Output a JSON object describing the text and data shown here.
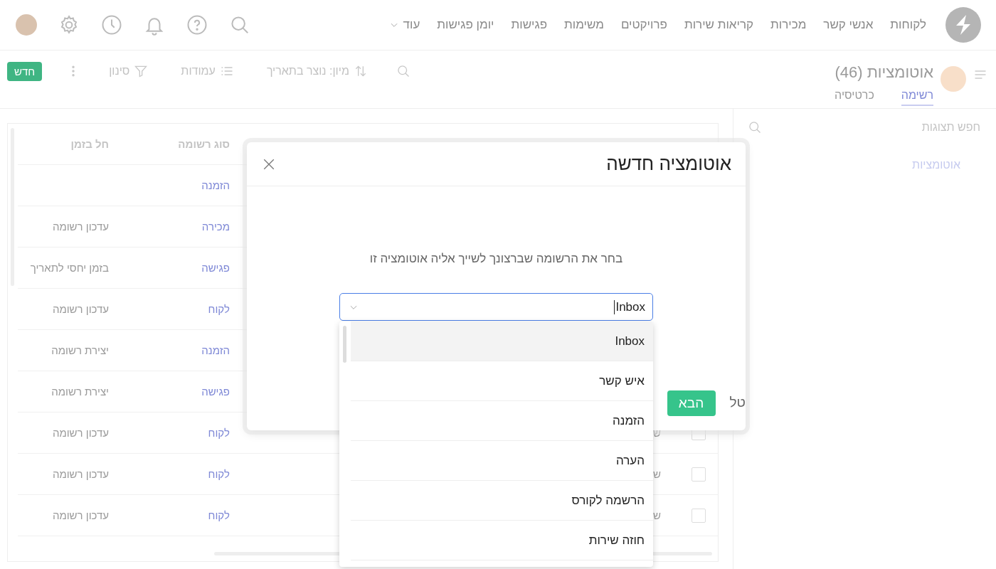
{
  "top_nav": {
    "items": [
      {
        "label": "לקוחות"
      },
      {
        "label": "אנשי קשר"
      },
      {
        "label": "מכירות"
      },
      {
        "label": "קריאות שירות"
      },
      {
        "label": "פרויקטים"
      },
      {
        "label": "משימות"
      },
      {
        "label": "פגישות"
      },
      {
        "label": "יומן פגישות"
      }
    ],
    "more": "עוד"
  },
  "page_header": {
    "title": "אוטומציות (46)",
    "tabs": [
      {
        "label": "רשימה",
        "selected": true
      },
      {
        "label": "כרטיסיה",
        "selected": false
      }
    ],
    "toolbar": {
      "sort": "מיון: נוצר בתאריך",
      "columns": "עמודות",
      "filter": "סינון",
      "new": "חדש"
    }
  },
  "sidebar": {
    "search": {
      "placeholder": "חפש תצוגות"
    },
    "items": [
      {
        "label": "אוטומציות",
        "selected": true
      }
    ]
  },
  "table": {
    "columns": [
      "סוג רשומה",
      "חל בזמן"
    ],
    "rows": [
      {
        "record_type": "הזמנה"
      },
      {
        "record_type": "מכירה",
        "applies_when": "עדכון רשומה"
      },
      {
        "record_type": "פגישה",
        "applies_when": "בזמן יחסי לתאריך"
      },
      {
        "record_type": "לקוח",
        "applies_when": "עדכון רשומה"
      },
      {
        "record_type": "הזמנה",
        "applies_when": "יצירת רשומה"
      },
      {
        "record_type": "פגישה",
        "applies_when": "יצירת רשומה"
      },
      {
        "checked": false,
        "name": "ש",
        "record_type": "לקוח",
        "applies_when": "עדכון רשומה"
      },
      {
        "checked": false,
        "name": "ש",
        "record_type": "לקוח",
        "applies_when": "עדכון רשומה"
      },
      {
        "checked": false,
        "name": "ש",
        "record_type": "לקוח",
        "applies_when": "עדכון רשומה"
      }
    ]
  },
  "modal": {
    "title": "אוטומציה חדשה",
    "prompt": "בחר את הרשומה שברצונך לשייך אליה אוטומציה זו",
    "select": {
      "value": "Inbox",
      "options": [
        {
          "label": "Inbox",
          "selected": true
        },
        {
          "label": "איש קשר",
          "selected": false
        },
        {
          "label": "הזמנה",
          "selected": false
        },
        {
          "label": "הערה",
          "selected": false
        },
        {
          "label": "הרשמה לקורס",
          "selected": false
        },
        {
          "label": "חוזה שירות",
          "selected": false
        }
      ]
    },
    "next_button": "הבא",
    "cancel_button": "טל"
  }
}
